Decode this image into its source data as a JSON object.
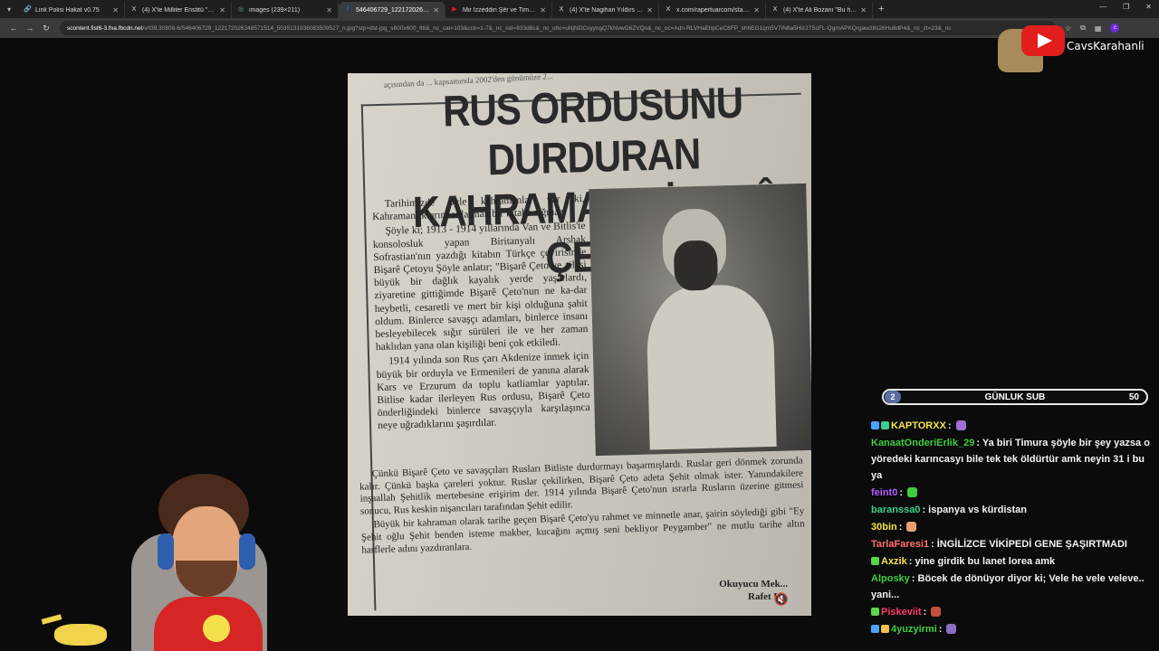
{
  "browser": {
    "tabs": [
      {
        "title": "Link Polisi Hakat v0.75",
        "favicon": "link-icon",
        "active": false
      },
      {
        "title": "(4) X'te Milliter Enstitü \"Yusuf T...",
        "favicon": "x-icon",
        "active": false
      },
      {
        "title": "images (239×211)",
        "favicon": "globe-icon",
        "active": false
      },
      {
        "title": "546406729_12217202634857151...",
        "favicon": "facebook-icon",
        "active": true
      },
      {
        "title": "Mir İzzeddin Şêr ve Timur Lenç",
        "favicon": "youtube-icon",
        "active": false
      },
      {
        "title": "(4) X'te Nagihan Yıldırs \"MHP'n...",
        "favicon": "x-icon",
        "active": false
      },
      {
        "title": "x.com/rapertuarcom/status/19...",
        "favicon": "x-icon",
        "active": false
      },
      {
        "title": "(4) X'te Ali Bozanı \"Bu hadsizlik...",
        "favicon": "x-icon",
        "active": false
      }
    ],
    "address": {
      "host": "scontent.fist6-3.fna.fbcdn.net",
      "path": "/v/t39.30808-6/546406729_122172026348571514_5035131938083509527_n.jpg?stp=dst-jpg_s600x600_tt6&_nc_cat=103&ccb=1-7&_nc_sid=833d8c&_nc_ohc=uNjNDCvyyngQ7kNvwG6ZVQn&_nc_oc=Adn-RLVHaEbpCeC8FP_shhEG1qm5V7iN8a5Hlz27ScFL-QgmAPKQrgaw28s26Hu6dP4&_nc_zt=23&_nc"
    }
  },
  "newspaper": {
    "top_cut": "açısından da ... kapsamında 2002'den günümüze 2...",
    "headline_line1": "RUS ORDUSUNU DURDURAN",
    "headline_line2": "KAHRAMAN BİŞARÊ ÇETO",
    "paragraphs_left": [
      "Tarihimizde öyle kahramanlar var ki, Kahramanlıklarını anlatmak bir kitaba sığmaz.",
      "Şöyle ki; 1913 - 1914 yıllarında Van ve Bitlis'te konsolosluk yapan Biritanyalı Arshak Sofrastian'nın yazdığı kitabın Türkçe çevirisinde Bişarê Çetoyu Şöyle anlatır; \"Bişarê Çeto ve ailesi büyük bir dağlık kayalık yerde yaşarlardı, ziyaretine gittiğimde Bişarê Çeto'nun ne ka-dar heybetli, cesaretli ve mert bir kişi olduğuna şahit oldum. Binlerce savaşçı adamları, binlerce insanı besleyebilecek sığır sürüleri ile ve her zaman haklıdan yana olan kişiliği beni çok etkiledi.",
      "1914 yılında son Rus çarı Akdenize inmek için büyük bir orduyla ve Ermenileri de yanına alarak Kars ve Erzurum da toplu katliamlar yaptılar. Bitlise kadar ilerleyen Rus ordusu, Bişarê Çeto önderliğindeki binlerce savaşçıyla karşılaşınca neye uğradıklarını şaşırdılar."
    ],
    "paragraphs_wide": [
      "Çünkü Bişarê Çeto ve savaşçıları Rusları Bitliste durdurmayı başarmışlardı. Ruslar geri dönmek zorunda kalır. Çünkü başka çareleri yoktur. Ruslar çekilirken, Bişarê Çeto adeta Şehit olmak ister. Yanındakilere inşaallah Şehitlik mertebesine erişirim der. 1914 yılında Bişarê Çeto'nun ısrarla Rusların üzerine gitmesi sonucu, Rus keskin nişancıları tarafından Şehit edilir.",
      "Büyük bir kahraman olarak tarihe geçen Bişarê Çeto'yu rahmet ve minnetle anar, şairin söylediği gibi \"Ey Şehit oğlu Şehit benden isteme makber, kucağını açmış seni bekliyor Peygamber\" ne mutlu tarihe altın harflerle adını yazdıranlara."
    ],
    "signature_line1": "Okuyucu Mek...",
    "signature_line2": "Rafet L..."
  },
  "stream": {
    "channel_name": "CavsKarahanli",
    "sub_goal": {
      "current": "2",
      "label": "GÜNLUK SUB",
      "target": "50",
      "progress": 0.04
    },
    "chat": [
      {
        "user": "KAPTORXX",
        "color": "#f4e34b",
        "badges": [
          "#4aa3ff",
          "#3ecf8e"
        ],
        "text": "",
        "emote": "#a070d0"
      },
      {
        "user": "KanaatOnderiErlik_29",
        "color": "#3ecf3e",
        "badges": [],
        "text": "Ya biri Timura şöyle bir şey yazsa o yöredeki karıncasyı bile tek tek öldürtür amk neyin 31 i bu ya",
        "emote": ""
      },
      {
        "user": "feint0",
        "color": "#b05cff",
        "badges": [],
        "text": "",
        "emote": "#3ecf3e"
      },
      {
        "user": "baranssa0",
        "color": "#3ecf8e",
        "badges": [],
        "text": "ispanya vs kürdistan",
        "emote": ""
      },
      {
        "user": "30bin",
        "color": "#f4e34b",
        "badges": [],
        "text": "",
        "emote": "#e8a070"
      },
      {
        "user": "TarlaFaresi1",
        "color": "#ff7070",
        "badges": [],
        "text": "İNGİLİZCE VİKİPEDİ GENE ŞAŞIRTMADI",
        "emote": ""
      },
      {
        "user": "Axzik",
        "color": "#f4e34b",
        "badges": [
          "#5bd64b"
        ],
        "text": "yine girdik bu lanet lorea amk",
        "emote": ""
      },
      {
        "user": "Alposky",
        "color": "#3ecf3e",
        "badges": [],
        "text": "Böcek de dönüyor diyor ki; Vele he vele veleve.. yani...",
        "emote": ""
      },
      {
        "user": "Piskeviit",
        "color": "#ff3b6b",
        "badges": [
          "#5bd64b"
        ],
        "text": "",
        "emote": "#c0503a"
      },
      {
        "user": "4yuzyirmi",
        "color": "#3ecf3e",
        "badges": [
          "#4aa3ff",
          "#f4c34b"
        ],
        "text": "",
        "emote": "#8a70c0"
      }
    ]
  },
  "colors": {
    "accent_red": "#e21d1d",
    "chrome_bg": "#1f1f1f",
    "page_bg": "#0b0b0b"
  }
}
